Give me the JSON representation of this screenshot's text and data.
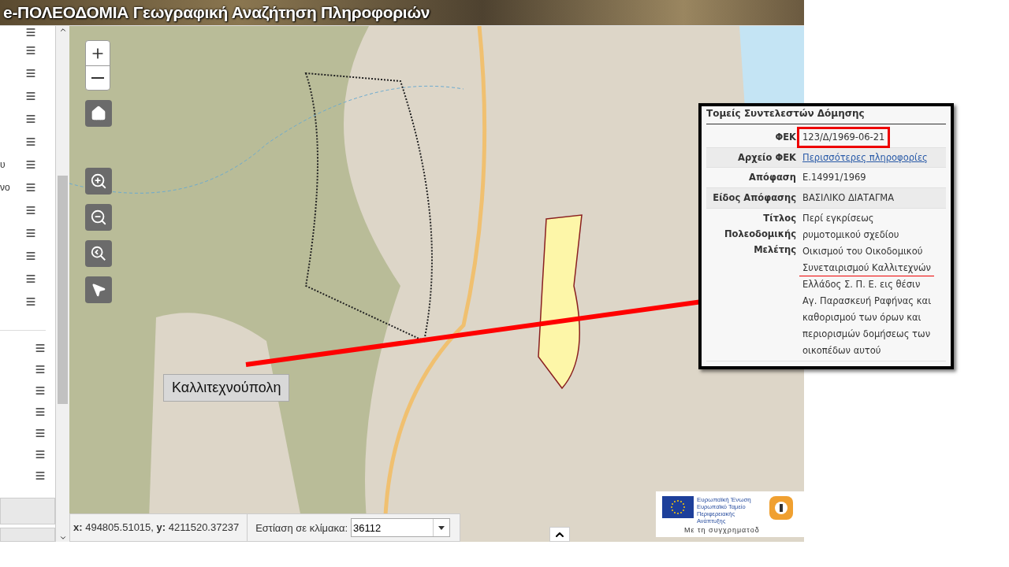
{
  "header": {
    "title": "e-ΠΟΛΕΟΔΟΜΙΑ Γεωγραφική Αναζήτηση Πληροφοριών"
  },
  "sidebar": {
    "groups": [
      {
        "items": [
          {
            "kind": "layer"
          },
          {
            "kind": "layer"
          },
          {
            "kind": "layer"
          },
          {
            "kind": "layer"
          },
          {
            "kind": "layer"
          },
          {
            "kind": "layer"
          },
          {
            "kind": "layer",
            "label": "υ"
          },
          {
            "kind": "layer",
            "label": "νο"
          },
          {
            "kind": "layer"
          },
          {
            "kind": "layer"
          },
          {
            "kind": "layer"
          },
          {
            "kind": "layer"
          },
          {
            "kind": "layer"
          }
        ]
      },
      {
        "items": [
          {
            "kind": "layer"
          },
          {
            "kind": "layer"
          },
          {
            "kind": "layer"
          },
          {
            "kind": "layer"
          },
          {
            "kind": "layer"
          },
          {
            "kind": "layer"
          },
          {
            "kind": "layer"
          }
        ]
      }
    ]
  },
  "map": {
    "callout": "Καλλιτεχνούπολη",
    "popup": {
      "title": "Τομείς Συντελεστών Δόμησης",
      "rows": [
        {
          "label": "ΦΕΚ",
          "kind": "text",
          "boxed": true,
          "lines": [
            {
              "text": "123/Δ/1969-06-21",
              "underlined": false
            }
          ]
        },
        {
          "label": "Αρχείο ΦΕΚ",
          "kind": "link",
          "lines": [
            {
              "text": "Περισσότερες πληροφορίες"
            }
          ]
        },
        {
          "label": "Απόφαση",
          "kind": "text",
          "boxed": false,
          "lines": [
            {
              "text": "Ε.14991/1969",
              "underlined": false
            }
          ]
        },
        {
          "label": "Είδος Απόφασης",
          "kind": "text",
          "boxed": false,
          "lines": [
            {
              "text": "ΒΑΣΙΛΙΚΟ ΔΙΑΤΑΓΜΑ",
              "underlined": false
            }
          ]
        },
        {
          "label": "Τίτλος Πολεοδομικής Μελέτης",
          "kind": "text",
          "boxed": false,
          "lines": [
            {
              "text": "Περί εγκρίσεως",
              "underlined": false
            },
            {
              "text": "ρυμοτομικού σχεδίου",
              "underlined": false
            },
            {
              "text": "Οικισμού του Οικοδομικού",
              "underlined": false
            },
            {
              "text": "Συνεταιρισμού Καλλιτεχνών",
              "underlined": true
            },
            {
              "text": "Ελλάδος Σ. Π. Ε. εις θέσιν",
              "underlined": false
            },
            {
              "text": "Αγ. Παρασκευή Ραφήνας και",
              "underlined": false
            },
            {
              "text": "καθορισμού των όρων και",
              "underlined": false
            },
            {
              "text": "περιορισμών δομήσεως των",
              "underlined": false
            },
            {
              "text": "οικοπέδων αυτού",
              "underlined": false
            }
          ]
        }
      ]
    },
    "coordinates": "**x:** 494805.51015, **y:** 4211520.37237",
    "scale": {
      "label": "Εστίαση σε κλίμακα:",
      "value": "36112"
    },
    "logos": {
      "eu_title": "Ευρωπαϊκή Ένωση",
      "eu_fund": "Ευρωπαϊκό Ταμείο Περιφερειακής Ανάπτυξης",
      "cofunding": "Με τη συγχρηματοδ"
    }
  }
}
